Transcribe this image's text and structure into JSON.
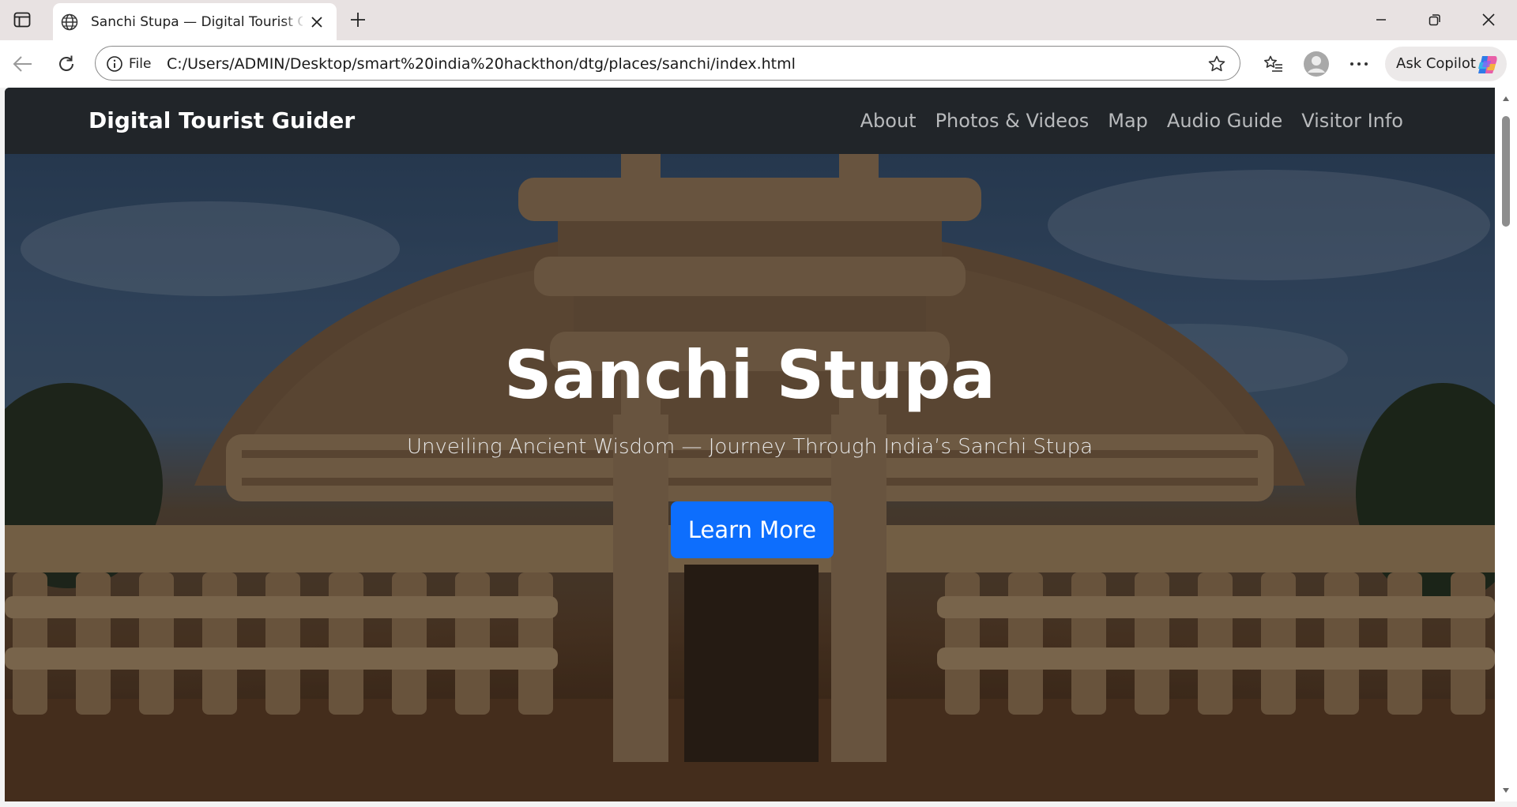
{
  "browser": {
    "tab": {
      "title": "Sanchi Stupa — Digital Tourist Guider"
    },
    "address": {
      "scheme_label": "File",
      "url": "C:/Users/ADMIN/Desktop/smart%20india%20hackthon/dtg/places/sanchi/index.html"
    },
    "copilot_label": "Ask Copilot",
    "icons": {
      "tab_actions": "tab-actions-icon",
      "favicon": "globe-icon",
      "close_tab": "close-icon",
      "new_tab": "plus-icon",
      "minimize": "minimize-icon",
      "restore": "restore-icon",
      "close_window": "close-icon",
      "back": "back-arrow-icon",
      "reload": "reload-icon",
      "site_info": "info-icon",
      "favorite": "star-icon",
      "favorites": "favorites-icon",
      "profile": "profile-icon",
      "more": "more-icon",
      "copilot": "copilot-icon"
    }
  },
  "site": {
    "brand": "Digital Tourist Guider",
    "nav": [
      {
        "label": "About"
      },
      {
        "label": "Photos & Videos"
      },
      {
        "label": "Map"
      },
      {
        "label": "Audio Guide"
      },
      {
        "label": "Visitor Info"
      }
    ],
    "hero": {
      "title": "Sanchi Stupa",
      "subtitle": "Unveiling Ancient Wisdom — Journey Through India’s Sanchi Stupa",
      "cta_label": "Learn More"
    }
  },
  "colors": {
    "navbar_bg": "#212529",
    "brand_text": "#ffffff",
    "nav_link": "#b8babc",
    "cta_bg": "#0d6efd"
  }
}
